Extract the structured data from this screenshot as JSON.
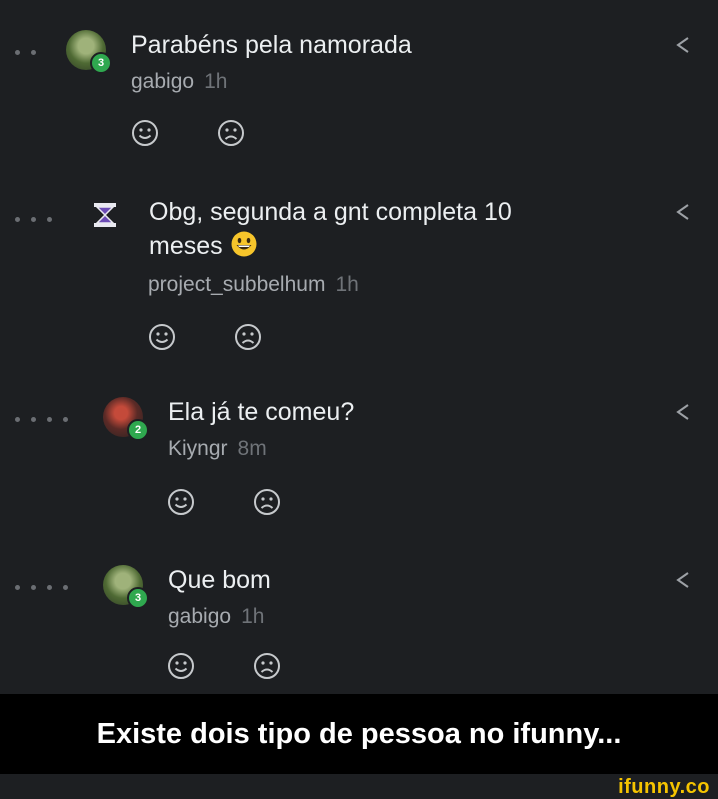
{
  "comments": [
    {
      "text": "Parabéns pela namorada",
      "user": "gabigo",
      "time": "1h",
      "badge": "3"
    },
    {
      "text": "Obg, segunda a gnt completa 10",
      "text2": "meses",
      "user": "project_subbelhum",
      "time": "1h"
    },
    {
      "text": "Ela já te comeu?",
      "user": "Kiyngr",
      "time": "8m",
      "badge": "2"
    },
    {
      "text": "Que bom",
      "user": "gabigo",
      "time": "1h",
      "badge": "3"
    }
  ],
  "caption": "Existe dois tipo de pessoa no ifunny...",
  "watermark": "ifunny.co",
  "colors": {
    "background": "#1d1f22",
    "badge": "#2fa84f",
    "watermark": "#f5c400"
  }
}
